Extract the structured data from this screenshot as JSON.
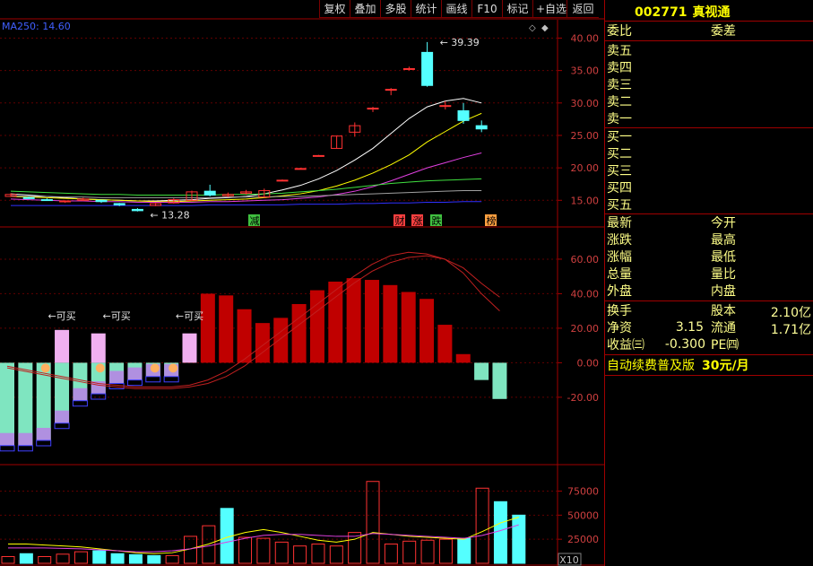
{
  "toolbar": {
    "buttons": [
      "复权",
      "叠加",
      "多股",
      "统计",
      "画线",
      "F10",
      "标记",
      "+自选",
      "返回"
    ]
  },
  "stock": {
    "code": "002771",
    "name": "真视通"
  },
  "indicator": {
    "ma_label": "MA250: 14.60"
  },
  "annotations": {
    "high_label": "39.39",
    "low_label": "13.28",
    "buy_labels": [
      "←可买",
      "←可买",
      "←可买"
    ],
    "events": [
      "减",
      "财",
      "涨",
      "跌",
      "榜"
    ],
    "volume_unit": "X10"
  },
  "axes": {
    "price_ticks": [
      "40.00",
      "35.00",
      "30.00",
      "25.00",
      "20.00",
      "15.00"
    ],
    "macd_ticks": [
      "60.00",
      "40.00",
      "20.00",
      "0.00",
      "-20.00"
    ],
    "volume_ticks": [
      "75000",
      "50000",
      "25000"
    ]
  },
  "side_panel": {
    "wei_bi": "委比",
    "wei_cha": "委差",
    "sell": [
      "卖五",
      "卖四",
      "卖三",
      "卖二",
      "卖一"
    ],
    "buy": [
      "买一",
      "买二",
      "买三",
      "买四",
      "买五"
    ],
    "stats_left": [
      "最新",
      "涨跌",
      "涨幅",
      "总量",
      "外盘"
    ],
    "stats_right": [
      "今开",
      "最高",
      "最低",
      "量比",
      "内盘"
    ],
    "turnover_label": "换手",
    "share_label": "股本",
    "share_value": "2.10亿",
    "net_asset_label": "净资",
    "net_asset_value": "3.15",
    "float_label": "流通",
    "float_value": "1.71亿",
    "eps_label": "收益㈢",
    "eps_value": "-0.300",
    "pe_label": "PE㈣",
    "ad_text": "自动续费普及版",
    "ad_price": "30元/月"
  },
  "colors": {
    "up_red": "#ff3232",
    "down_cyan": "#54ffff",
    "macd_red": "#c00000",
    "macd_green": "#7fe5c0",
    "grid_red": "#a00000",
    "ma_white": "#ffffff",
    "ma_yellow": "#ffff00",
    "ma_magenta": "#e040e0",
    "ma_green": "#40e040"
  },
  "chart_data": [
    {
      "type": "candlestick",
      "title": "",
      "ylim": [
        12,
        42
      ],
      "candles": [
        {
          "o": 15.6,
          "c": 15.9,
          "h": 16.1,
          "l": 15.5
        },
        {
          "o": 15.4,
          "c": 15.3,
          "h": 15.6,
          "l": 15.2
        },
        {
          "o": 15.1,
          "c": 15.0,
          "h": 15.3,
          "l": 14.9
        },
        {
          "o": 14.8,
          "c": 14.9,
          "h": 15.0,
          "l": 14.6
        },
        {
          "o": 15.0,
          "c": 15.2,
          "h": 15.4,
          "l": 14.9
        },
        {
          "o": 15.0,
          "c": 14.8,
          "h": 15.1,
          "l": 14.6
        },
        {
          "o": 14.5,
          "c": 14.3,
          "h": 14.6,
          "l": 14.1
        },
        {
          "o": 13.6,
          "c": 13.4,
          "h": 13.8,
          "l": 13.28
        },
        {
          "o": 14.2,
          "c": 14.5,
          "h": 14.6,
          "l": 14.1
        },
        {
          "o": 14.6,
          "c": 15.1,
          "h": 15.3,
          "l": 14.5
        },
        {
          "o": 15.0,
          "c": 16.3,
          "h": 16.5,
          "l": 14.9
        },
        {
          "o": 16.4,
          "c": 15.8,
          "h": 17.4,
          "l": 15.6
        },
        {
          "o": 15.7,
          "c": 15.9,
          "h": 16.2,
          "l": 15.5
        },
        {
          "o": 16.1,
          "c": 16.3,
          "h": 16.6,
          "l": 15.9
        },
        {
          "o": 15.5,
          "c": 16.5,
          "h": 16.8,
          "l": 15.4
        },
        {
          "o": 18.1,
          "c": 18.1,
          "h": 18.2,
          "l": 18.0
        },
        {
          "o": 19.9,
          "c": 19.9,
          "h": 20.0,
          "l": 19.8
        },
        {
          "o": 21.9,
          "c": 21.9,
          "h": 22.0,
          "l": 21.8
        },
        {
          "o": 23.0,
          "c": 24.9,
          "h": 24.9,
          "l": 23.0
        },
        {
          "o": 25.5,
          "c": 26.5,
          "h": 27.0,
          "l": 24.8
        },
        {
          "o": 29.2,
          "c": 29.2,
          "h": 29.4,
          "l": 28.6
        },
        {
          "o": 32.1,
          "c": 32.1,
          "h": 32.3,
          "l": 31.2
        },
        {
          "o": 35.3,
          "c": 35.3,
          "h": 35.6,
          "l": 35.0
        },
        {
          "o": 37.8,
          "c": 32.7,
          "h": 39.39,
          "l": 32.5
        },
        {
          "o": 29.6,
          "c": 29.6,
          "h": 30.3,
          "l": 29.0
        },
        {
          "o": 28.8,
          "c": 27.3,
          "h": 30.0,
          "l": 26.8
        },
        {
          "o": 26.5,
          "c": 26.0,
          "h": 27.3,
          "l": 25.5
        }
      ],
      "ma_series": [
        {
          "color": "white",
          "values": [
            16,
            15.8,
            15.6,
            15.4,
            15.2,
            15.1,
            15,
            14.9,
            14.9,
            15,
            15.1,
            15.3,
            15.4,
            15.6,
            16,
            16.6,
            17.3,
            18.3,
            19.6,
            21.2,
            23,
            25.3,
            27.6,
            29.4,
            30.3,
            30.7,
            30
          ]
        },
        {
          "color": "yellow",
          "values": [
            15.6,
            15.5,
            15.4,
            15.3,
            15.2,
            15.1,
            15,
            14.9,
            14.8,
            14.8,
            14.9,
            15,
            15.1,
            15.2,
            15.4,
            15.7,
            16,
            16.5,
            17.2,
            18.1,
            19.2,
            20.5,
            22,
            24,
            25.6,
            27.2,
            28.4
          ]
        },
        {
          "color": "magenta",
          "values": [
            15.2,
            15.1,
            15,
            14.9,
            14.9,
            14.8,
            14.8,
            14.7,
            14.7,
            14.7,
            14.7,
            14.8,
            14.8,
            14.9,
            15,
            15.1,
            15.3,
            15.5,
            15.9,
            16.4,
            17.1,
            18,
            19,
            20,
            20.8,
            21.6,
            22.3
          ]
        },
        {
          "color": "green",
          "values": [
            16.4,
            16.3,
            16.2,
            16.1,
            16,
            15.9,
            15.9,
            15.8,
            15.8,
            15.8,
            15.8,
            15.8,
            15.9,
            15.9,
            16,
            16.1,
            16.3,
            16.5,
            16.7,
            17,
            17.3,
            17.6,
            17.8,
            18,
            18.1,
            18.2,
            18.3
          ]
        },
        {
          "color": "gray",
          "values": [
            15.7,
            15.6,
            15.6,
            15.5,
            15.5,
            15.4,
            15.4,
            15.4,
            15.4,
            15.4,
            15.4,
            15.4,
            15.5,
            15.5,
            15.5,
            15.6,
            15.6,
            15.7,
            15.8,
            15.9,
            16,
            16.1,
            16.2,
            16.3,
            16.4,
            16.5,
            16.5
          ]
        },
        {
          "color": "blue",
          "values": [
            14.2,
            14.2,
            14.2,
            14.2,
            14.2,
            14.2,
            14.2,
            14.2,
            14.2,
            14.2,
            14.2,
            14.3,
            14.3,
            14.3,
            14.3,
            14.3,
            14.4,
            14.4,
            14.4,
            14.5,
            14.5,
            14.6,
            14.6,
            14.7,
            14.7,
            14.8,
            14.8
          ]
        }
      ]
    },
    {
      "type": "bar",
      "title": "",
      "ylim": [
        -58,
        74
      ],
      "values": [
        -48,
        -48,
        -45,
        -35,
        -22,
        -18,
        -12,
        -10,
        -8,
        -8,
        15,
        40,
        39,
        31,
        23,
        26,
        34,
        42,
        47,
        49,
        48,
        45,
        41,
        37,
        22,
        5,
        -10,
        -21
      ],
      "ghost_values": [
        null,
        null,
        null,
        19,
        null,
        17,
        null,
        null,
        null,
        null,
        17,
        null,
        null,
        null,
        null,
        null,
        null,
        null,
        null,
        null,
        null,
        null,
        null,
        null,
        null,
        null,
        null,
        null
      ],
      "lines": [
        {
          "color": "red",
          "values": [
            -2,
            -4,
            -6,
            -8,
            -10,
            -12,
            -13,
            -14,
            -14,
            -14,
            -13,
            -10,
            -5,
            2,
            10,
            18,
            26,
            34,
            42,
            50,
            57,
            62,
            64,
            63,
            60,
            52,
            40,
            30
          ]
        },
        {
          "color": "red",
          "values": [
            -3,
            -5,
            -7,
            -9,
            -11,
            -13,
            -14,
            -15,
            -15,
            -15,
            -14,
            -12,
            -8,
            -2,
            6,
            14,
            22,
            30,
            38,
            46,
            53,
            58,
            61,
            62,
            60,
            55,
            46,
            38
          ]
        }
      ]
    },
    {
      "type": "bar",
      "title": "",
      "ylim": [
        0,
        95000
      ],
      "values": [
        7000,
        10000,
        7000,
        9500,
        12000,
        13000,
        10000,
        9000,
        8000,
        8000,
        28000,
        39000,
        57000,
        27000,
        26000,
        22000,
        18000,
        20000,
        18000,
        32000,
        85000,
        20000,
        23000,
        24000,
        25000,
        26000,
        78000,
        64000,
        50000
      ],
      "up": [
        true,
        false,
        true,
        true,
        true,
        false,
        false,
        false,
        false,
        true,
        true,
        true,
        false,
        true,
        true,
        true,
        true,
        true,
        true,
        true,
        true,
        true,
        true,
        true,
        true,
        false,
        true,
        false,
        false
      ],
      "lines": [
        {
          "color": "yellow",
          "values": [
            20000,
            20000,
            19000,
            18000,
            17000,
            15000,
            13000,
            11000,
            10000,
            11000,
            15000,
            20000,
            27000,
            32000,
            35000,
            32000,
            28000,
            24000,
            22000,
            25000,
            32000,
            30000,
            28000,
            27000,
            26000,
            25000,
            33000,
            42000,
            48000
          ]
        },
        {
          "color": "magenta",
          "values": [
            16000,
            16000,
            16000,
            15500,
            15000,
            14000,
            13000,
            12000,
            12000,
            13000,
            15000,
            18000,
            22000,
            26000,
            29000,
            30000,
            30000,
            29000,
            28000,
            28000,
            31000,
            30000,
            29000,
            28000,
            27000,
            26000,
            29000,
            34000,
            40000
          ]
        }
      ]
    }
  ]
}
